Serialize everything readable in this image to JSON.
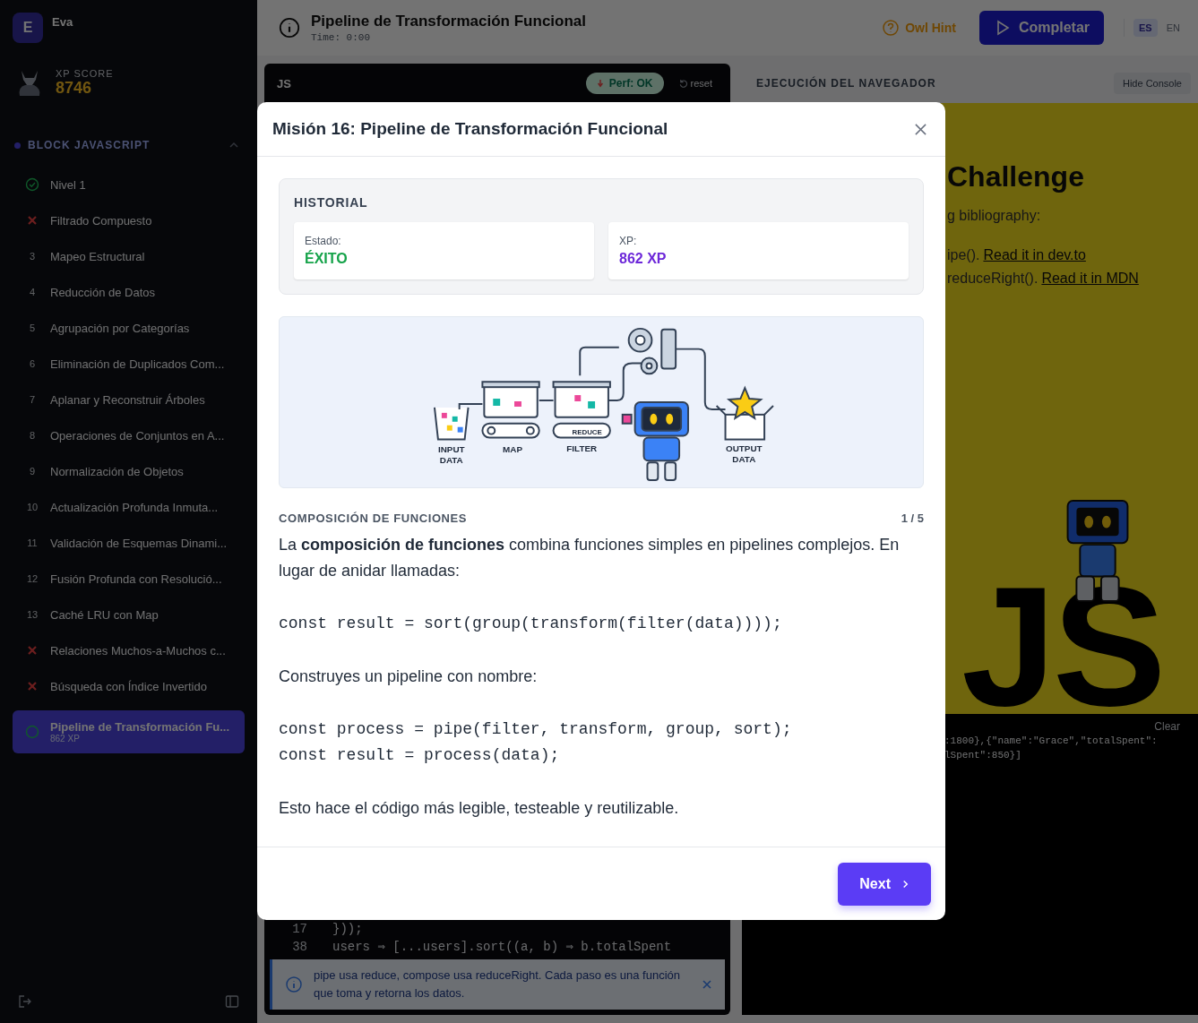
{
  "sidebar": {
    "user": {
      "initial": "E",
      "name": "Eva"
    },
    "score": {
      "label": "XP SCORE",
      "value": "8746"
    },
    "section": {
      "title": "BLOCK JAVASCRIPT",
      "expanded": true
    },
    "levels": [
      {
        "kind": "done",
        "title": "Nivel 1",
        "selected": false
      },
      {
        "kind": "failed",
        "title": "Filtrado Compuesto",
        "selected": false
      },
      {
        "kind": "locked",
        "number": "3",
        "title": "Mapeo Estructural",
        "selected": false
      },
      {
        "kind": "locked",
        "number": "4",
        "title": "Reducción de Datos",
        "selected": false
      },
      {
        "kind": "locked",
        "number": "5",
        "title": "Agrupación por Categorías",
        "selected": false
      },
      {
        "kind": "locked",
        "number": "6",
        "title": "Eliminación de Duplicados Com...",
        "selected": false
      },
      {
        "kind": "locked",
        "number": "7",
        "title": "Aplanar y Reconstruir Árboles",
        "selected": false
      },
      {
        "kind": "locked",
        "number": "8",
        "title": "Operaciones de Conjuntos en A...",
        "selected": false
      },
      {
        "kind": "locked",
        "number": "9",
        "title": "Normalización de Objetos",
        "selected": false
      },
      {
        "kind": "locked",
        "number": "10",
        "title": "Actualización Profunda Inmuta...",
        "selected": false
      },
      {
        "kind": "locked",
        "number": "11",
        "title": "Validación de Esquemas Dinami...",
        "selected": false
      },
      {
        "kind": "locked",
        "number": "12",
        "title": "Fusión Profunda con Resolució...",
        "selected": false
      },
      {
        "kind": "locked",
        "number": "13",
        "title": "Caché LRU con Map",
        "selected": false
      },
      {
        "kind": "failed",
        "title": "Relaciones Muchos-a-Muchos c...",
        "selected": false
      },
      {
        "kind": "failed",
        "title": "Búsqueda con Índice Invertido",
        "selected": false
      },
      {
        "kind": "current",
        "title": "Pipeline de Transformación Fu...",
        "subtitle": "862 XP",
        "selected": true
      }
    ]
  },
  "header": {
    "title": "Pipeline de Transformación Funcional",
    "timer": "Time: 0:00",
    "hint_button": "Owl Hint",
    "complete_button": "Completar",
    "languages": [
      {
        "label": "ES",
        "selected": true
      },
      {
        "label": "EN",
        "selected": false
      }
    ]
  },
  "editor": {
    "tab": "JS",
    "perf_badge": "Perf: OK",
    "reset_button": "reset",
    "lines": [
      {
        "number": "17",
        "code": "}));"
      },
      {
        "number": "38",
        "code": "users ⇒ [...users].sort((a, b) ⇒ b.totalSpent"
      }
    ],
    "tip": "pipe usa reduce, compose usa reduceRight. Cada paso es una función que toma y retorna los datos."
  },
  "preview": {
    "title": "EJECUCIÓN DEL NAVEGADOR",
    "hide_button": "Hide Console",
    "heading": "Challenge",
    "intro": "g bibliography:",
    "links": [
      {
        "text": "ipe().",
        "link": "Read it in dev.to"
      },
      {
        "text": "reduceRight().",
        "link": "Read it in MDN"
      }
    ],
    "logo_text": "JS",
    "console_clear": "Clear",
    "console_lines": [
      ":1800},{\"name\":\"Grace\",\"totalSpent\":",
      "lSpent\":850}]"
    ]
  },
  "modal": {
    "title": "Misión 16: Pipeline de Transformación Funcional",
    "history": {
      "title": "HISTORIAL",
      "cards": [
        {
          "kind": "status",
          "label": "Estado:",
          "value": "ÉXITO"
        },
        {
          "kind": "xp",
          "label": "XP:",
          "value": "862 XP"
        }
      ]
    },
    "illustration": {
      "labels": [
        "INPUT DATA",
        "MAP",
        "FILTER",
        "REDUCE",
        "OUTPUT DATA"
      ]
    },
    "section_title": "COMPOSICIÓN DE FUNCIONES",
    "page": "1 / 5",
    "blocks": [
      {
        "kind": "text",
        "text": "La **composición de funciones** combina funciones simples en pipelines complejos. En lugar de anidar llamadas:"
      },
      {
        "kind": "code",
        "lines": [
          "const result = sort(group(transform(filter(data))));"
        ]
      },
      {
        "kind": "text",
        "text": "Construyes un pipeline con nombre:"
      },
      {
        "kind": "code",
        "lines": [
          "const process = pipe(filter, transform, group, sort);",
          "const result = process(data);"
        ]
      },
      {
        "kind": "text",
        "text": "Esto hace el código más legible, testeable y reutilizable."
      }
    ],
    "next_button": "Next"
  }
}
